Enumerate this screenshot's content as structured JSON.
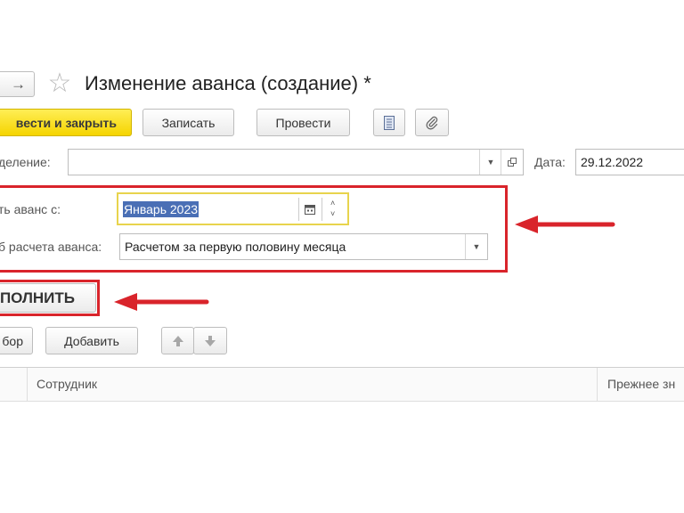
{
  "header": {
    "title": "Изменение аванса (создание) *",
    "forward_glyph": "→",
    "star_glyph": "☆"
  },
  "toolbar": {
    "post_close_label": "вести и закрыть",
    "save_label": "Записать",
    "post_label": "Провести"
  },
  "form": {
    "division_label": "деление:",
    "division_value": "",
    "date_label": "Дата:",
    "date_value": "29.12.2022",
    "advance_from_label": "ть аванс с:",
    "advance_from_value": "Январь 2023",
    "calc_method_label": "б расчета аванса:",
    "calc_method_value": "Расчетом за первую половину месяца"
  },
  "fill_button_label": "ПОЛНИТЬ",
  "table_toolbar": {
    "select_label": "бор",
    "add_label": "Добавить"
  },
  "table": {
    "columns": [
      "Сотрудник",
      "Прежнее зн"
    ]
  },
  "colors": {
    "accent_yellow": "#f5d400",
    "highlight_red": "#d9242b",
    "selection_blue": "#4a6fb5"
  }
}
